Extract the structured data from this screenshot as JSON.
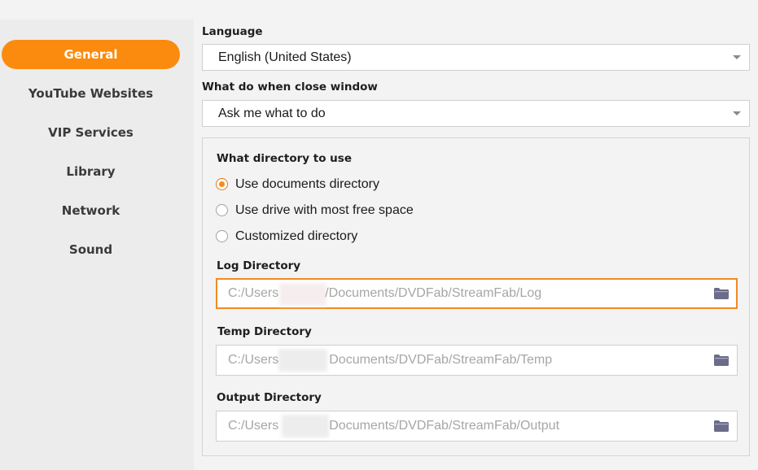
{
  "sidebar": {
    "items": [
      {
        "label": "General",
        "active": true
      },
      {
        "label": "YouTube Websites",
        "active": false
      },
      {
        "label": "VIP Services",
        "active": false
      },
      {
        "label": "Library",
        "active": false
      },
      {
        "label": "Network",
        "active": false
      },
      {
        "label": "Sound",
        "active": false
      }
    ]
  },
  "language": {
    "label": "Language",
    "value": "English (United States)"
  },
  "close_window": {
    "label": "What do when close window",
    "value": "Ask me what to do"
  },
  "directory": {
    "label": "What directory to use",
    "options": [
      {
        "label": "Use documents directory",
        "checked": true
      },
      {
        "label": "Use drive with most free space",
        "checked": false
      },
      {
        "label": "Customized directory",
        "checked": false
      }
    ]
  },
  "log_dir": {
    "label": "Log Directory",
    "prefix": "C:/Users",
    "suffix": "/Documents/DVDFab/StreamFab/Log"
  },
  "temp_dir": {
    "label": "Temp Directory",
    "prefix": "C:/Users",
    "suffix": "Documents/DVDFab/StreamFab/Temp"
  },
  "output_dir": {
    "label": "Output Directory",
    "prefix": "C:/Users",
    "suffix": "Documents/DVDFab/StreamFab/Output"
  },
  "icons": {
    "dropdown": "chevron-down-icon",
    "folder": "folder-icon"
  },
  "colors": {
    "accent": "#fb8b0e",
    "sidebar_bg": "#ececec",
    "page_bg": "#f3f3f3",
    "placeholder_text": "#a6a6a6",
    "folder_icon": "#6b6b8a"
  }
}
